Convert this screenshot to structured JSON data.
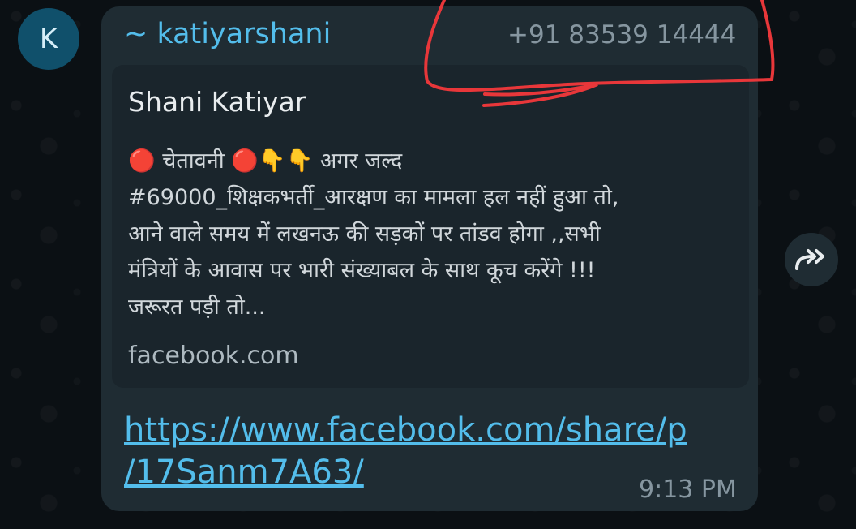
{
  "message": {
    "avatar_initial": "K",
    "sender_name": "~ katiyarshani",
    "sender_phone": "+91 83539 14444",
    "link_preview": {
      "title": "Shani Katiyar",
      "description_lines": [
        "🔴 चेतावनी 🔴👇👇 अगर जल्द",
        "#69000_शिक्षकभर्ती_आरक्षण का मामला हल नहीं हुआ तो,",
        "आने वाले समय में लखनऊ की सड़कों पर तांडव होगा ,,सभी",
        "मंत्रियों के आवास पर भारी संख्याबल के साथ कूच करेंगे !!!",
        "जरूरत पड़ी तो..."
      ],
      "domain": "facebook.com"
    },
    "link_lines": [
      "https://www.facebook.com/share/p",
      "/17Sanm7A63/"
    ],
    "time": "9:13 PM"
  },
  "colors": {
    "wallpaper": "#0b1014",
    "bubble": "#1f2c33",
    "preview_card": "#1a252c",
    "sender_name": "#53bdeb",
    "link": "#53bdeb",
    "meta_text": "#8696a0",
    "annotation_stroke": "#e8373a"
  },
  "icons": {
    "forward": "forward-arrow-icon"
  }
}
